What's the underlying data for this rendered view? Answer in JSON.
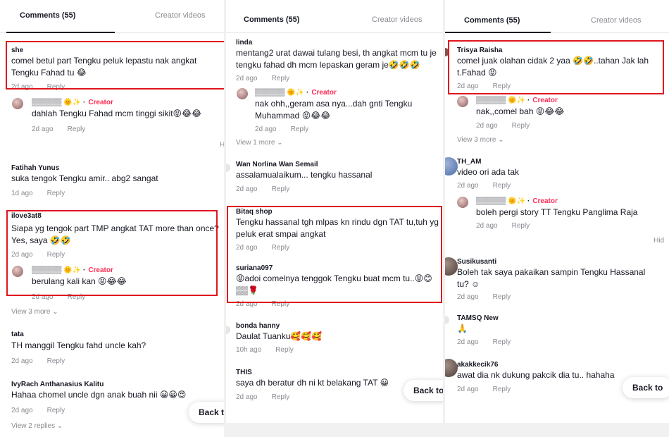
{
  "tabs": {
    "comments": "Comments (55)",
    "creator_videos": "Creator videos"
  },
  "common": {
    "reply": "Reply",
    "creator": "Creator",
    "back": "Back to",
    "back_cut": "Back t",
    "view_3_more": "View 3 more",
    "view_2_replies": "View 2 replies",
    "view_1_more": "View 1 more",
    "hidden_cut": "H",
    "hidden_cut_3": "Hid",
    "creator_name": "▒▒▒▒▒▒ 🌞✨ ·"
  },
  "panel1": {
    "c1": {
      "user": "she",
      "text": "comel betul part Tengku peluk lepastu nak angkat Tengku Fahad tu 😂",
      "time": "2d ago"
    },
    "r1": {
      "text": "dahlah Tengku Fahad mcm tinggi sikit😝😂😂",
      "time": "2d ago"
    },
    "c2": {
      "user": "Fatihah Yunus",
      "text": "suka tengok Tengku amir.. abg2 sangat",
      "time": "1d ago"
    },
    "c3": {
      "user": "ilove3at8",
      "text": "Siapa yg tengok part TMP angkat TAT more than once? Yes, saya 🤣🤣",
      "time": "2d ago"
    },
    "r3": {
      "text": "berulang kali kan 😝😂😂",
      "time": "2d ago"
    },
    "c4": {
      "user": "tata",
      "text": "TH manggil Tengku fahd uncle kah?",
      "time": "2d ago"
    },
    "c5": {
      "user": "IvyRach Anthanasius Kalitu",
      "text": "Hahaa chomel uncle dgn anak buah nii 😀😀😍",
      "time": "2d ago"
    }
  },
  "panel2": {
    "c1": {
      "user": "linda",
      "text": "mentang2 urat dawai tulang besi, th angkat mcm tu je tengku fahad dh mcm lepaskan geram je🤣🤣🤣",
      "time": "2d ago"
    },
    "r1": {
      "text": "nak ohh,,geram asa nya...dah gnti Tengku Muhammad 😝😂😂",
      "time": "2d ago"
    },
    "c2": {
      "user": "Wan Norlina Wan Semail",
      "text": "assalamualaikum... tengku hassanal",
      "time": "2d ago"
    },
    "c3": {
      "user": "Bitaq shop",
      "text": "Tengku hassanal tgh mlpas kn rindu dgn TAT tu,tuh yg peluk erat smpai angkat",
      "time": "2d ago"
    },
    "c4": {
      "user": "suriana097",
      "text": "😝adoi comelnya tenggok Tengku buat mcm tu..😝😊▒▒🌹",
      "time": "2d ago"
    },
    "c5": {
      "user": "bonda hanny",
      "text": "Daulat Tuanku🥰🥰🥰",
      "time": "10h ago"
    },
    "c6": {
      "user": "THIS",
      "text": "saya dh beratur dh ni kt belakang TAT 😀",
      "time": "2d ago"
    }
  },
  "panel3": {
    "c1": {
      "user": "Trisya Raisha",
      "text": "comel juak olahan cidak 2 yaa 🤣🤣..tahan Jak lah t.Fahad 😝",
      "time": "2d ago"
    },
    "r1": {
      "text": "nak,,comel bah 😝😂😂",
      "time": "2d ago"
    },
    "c2": {
      "user": "TH_AM",
      "text": "video ori ada tak",
      "time": "2d ago"
    },
    "r2": {
      "text": "boleh pergi story TT Tengku Panglima Raja",
      "time": "2d ago"
    },
    "c3": {
      "user": "Susikusanti",
      "text": "Boleh tak saya pakaikan sampin Tengku Hassanal tu? ☺",
      "time": "2d ago"
    },
    "c4": {
      "user": "TAMSQ New",
      "text": "🙏",
      "time": "2d ago"
    },
    "c5": {
      "user": "akakkecik76",
      "text": "awat dia nk dukung pakcik dia tu.. hahaha",
      "time": "2d ago"
    }
  },
  "colors": {
    "highlight": "#e0161f",
    "creator_tag": "#fe2c55",
    "muted": "#8a8b91"
  }
}
